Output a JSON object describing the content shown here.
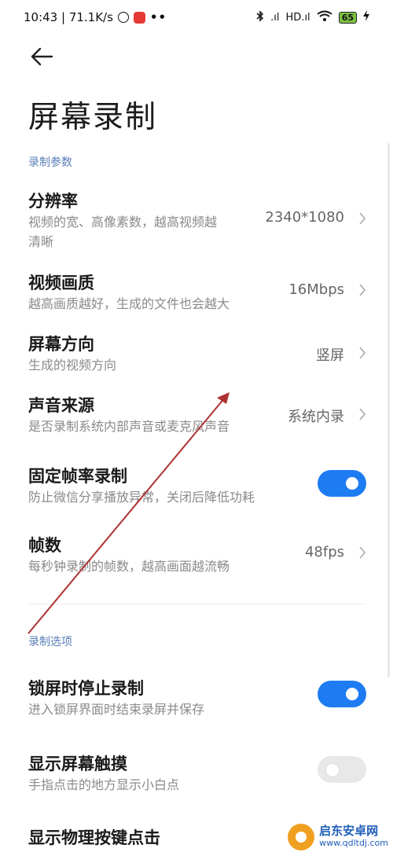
{
  "status_bar": {
    "time_speed": "10:43 | 71.1K/s",
    "dots": "••",
    "signal1": ".ıl",
    "signal2": "HD.ıl",
    "battery": "65"
  },
  "header": {
    "title": "屏幕录制"
  },
  "sections": {
    "params_label": "录制参数",
    "options_label": "录制选项"
  },
  "rows": {
    "resolution": {
      "title": "分辨率",
      "subtitle_line1": "视频的宽、高像素数，越高视频越",
      "subtitle_line2": "清晰",
      "value": "2340*1080"
    },
    "quality": {
      "title": "视频画质",
      "subtitle": "越高画质越好，生成的文件也会越大",
      "value": "16Mbps"
    },
    "orientation": {
      "title": "屏幕方向",
      "subtitle": "生成的视频方向",
      "value": "竖屏"
    },
    "audio": {
      "title": "声音来源",
      "subtitle": "是否录制系统内部声音或麦克风声音",
      "value": "系统内录"
    },
    "fixed_fps": {
      "title": "固定帧率录制",
      "subtitle": "防止微信分享播放异常，关闭后降低功耗",
      "enabled": true
    },
    "fps": {
      "title": "帧数",
      "subtitle": "每秒钟录制的帧数，越高画面越流畅",
      "value": "48fps"
    },
    "lock_stop": {
      "title": "锁屏时停止录制",
      "subtitle": "进入锁屏界面时结束录屏并保存",
      "enabled": true
    },
    "show_touch": {
      "title": "显示屏幕触摸",
      "subtitle": "手指点击的地方显示小白点",
      "enabled": false
    },
    "show_keys": {
      "title": "显示物理按键点击"
    }
  },
  "watermark": {
    "title": "启东安卓网",
    "url": "www.qdltdj.com"
  },
  "colors": {
    "accent": "#1e7cf2",
    "section": "#5a7fb6",
    "annotation_arrow": "#b03030"
  }
}
